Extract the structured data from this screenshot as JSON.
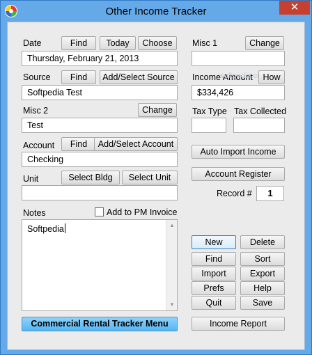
{
  "window": {
    "title": "Other Income Tracker",
    "close_glyph": "✕",
    "icon": "app-color-wheel-icon"
  },
  "date": {
    "label": "Date",
    "find": "Find",
    "today": "Today",
    "choose": "Choose",
    "value": "Thursday, February 21, 2013"
  },
  "source": {
    "label": "Source",
    "find": "Find",
    "add_select": "Add/Select Source",
    "value": "Softpedia Test"
  },
  "misc2": {
    "label": "Misc 2",
    "change": "Change",
    "value": "Test"
  },
  "account": {
    "label": "Account",
    "find": "Find",
    "add_select": "Add/Select Account",
    "value": "Checking"
  },
  "unit": {
    "label": "Unit",
    "select_bldg": "Select Bldg",
    "select_unit": "Select Unit",
    "value": ""
  },
  "notes": {
    "label": "Notes",
    "pm_invoice_label": "Add to PM Invoice",
    "value": "Softpedia"
  },
  "misc1": {
    "label": "Misc 1",
    "change": "Change",
    "value": ""
  },
  "income_amount": {
    "label": "Income Amount",
    "how": "How",
    "value": "$334,426"
  },
  "tax": {
    "type_label": "Tax Type",
    "collected_label": "Tax Collected",
    "type_value": "",
    "collected_value": ""
  },
  "actions": {
    "auto_import": "Auto Import Income",
    "account_register": "Account Register",
    "record_label": "Record #",
    "record_value": "1",
    "new": "New",
    "delete": "Delete",
    "find": "Find",
    "sort": "Sort",
    "import": "Import",
    "export": "Export",
    "prefs": "Prefs",
    "help": "Help",
    "quit": "Quit",
    "save": "Save",
    "income_report": "Income Report",
    "commercial_menu": "Commercial Rental Tracker Menu"
  },
  "watermark": "softpedia.com",
  "colors": {
    "window_frame": "#65a9e8",
    "close_button": "#c7402f",
    "client_bg": "#ecebeb",
    "menu_button": "#54b6f3"
  }
}
